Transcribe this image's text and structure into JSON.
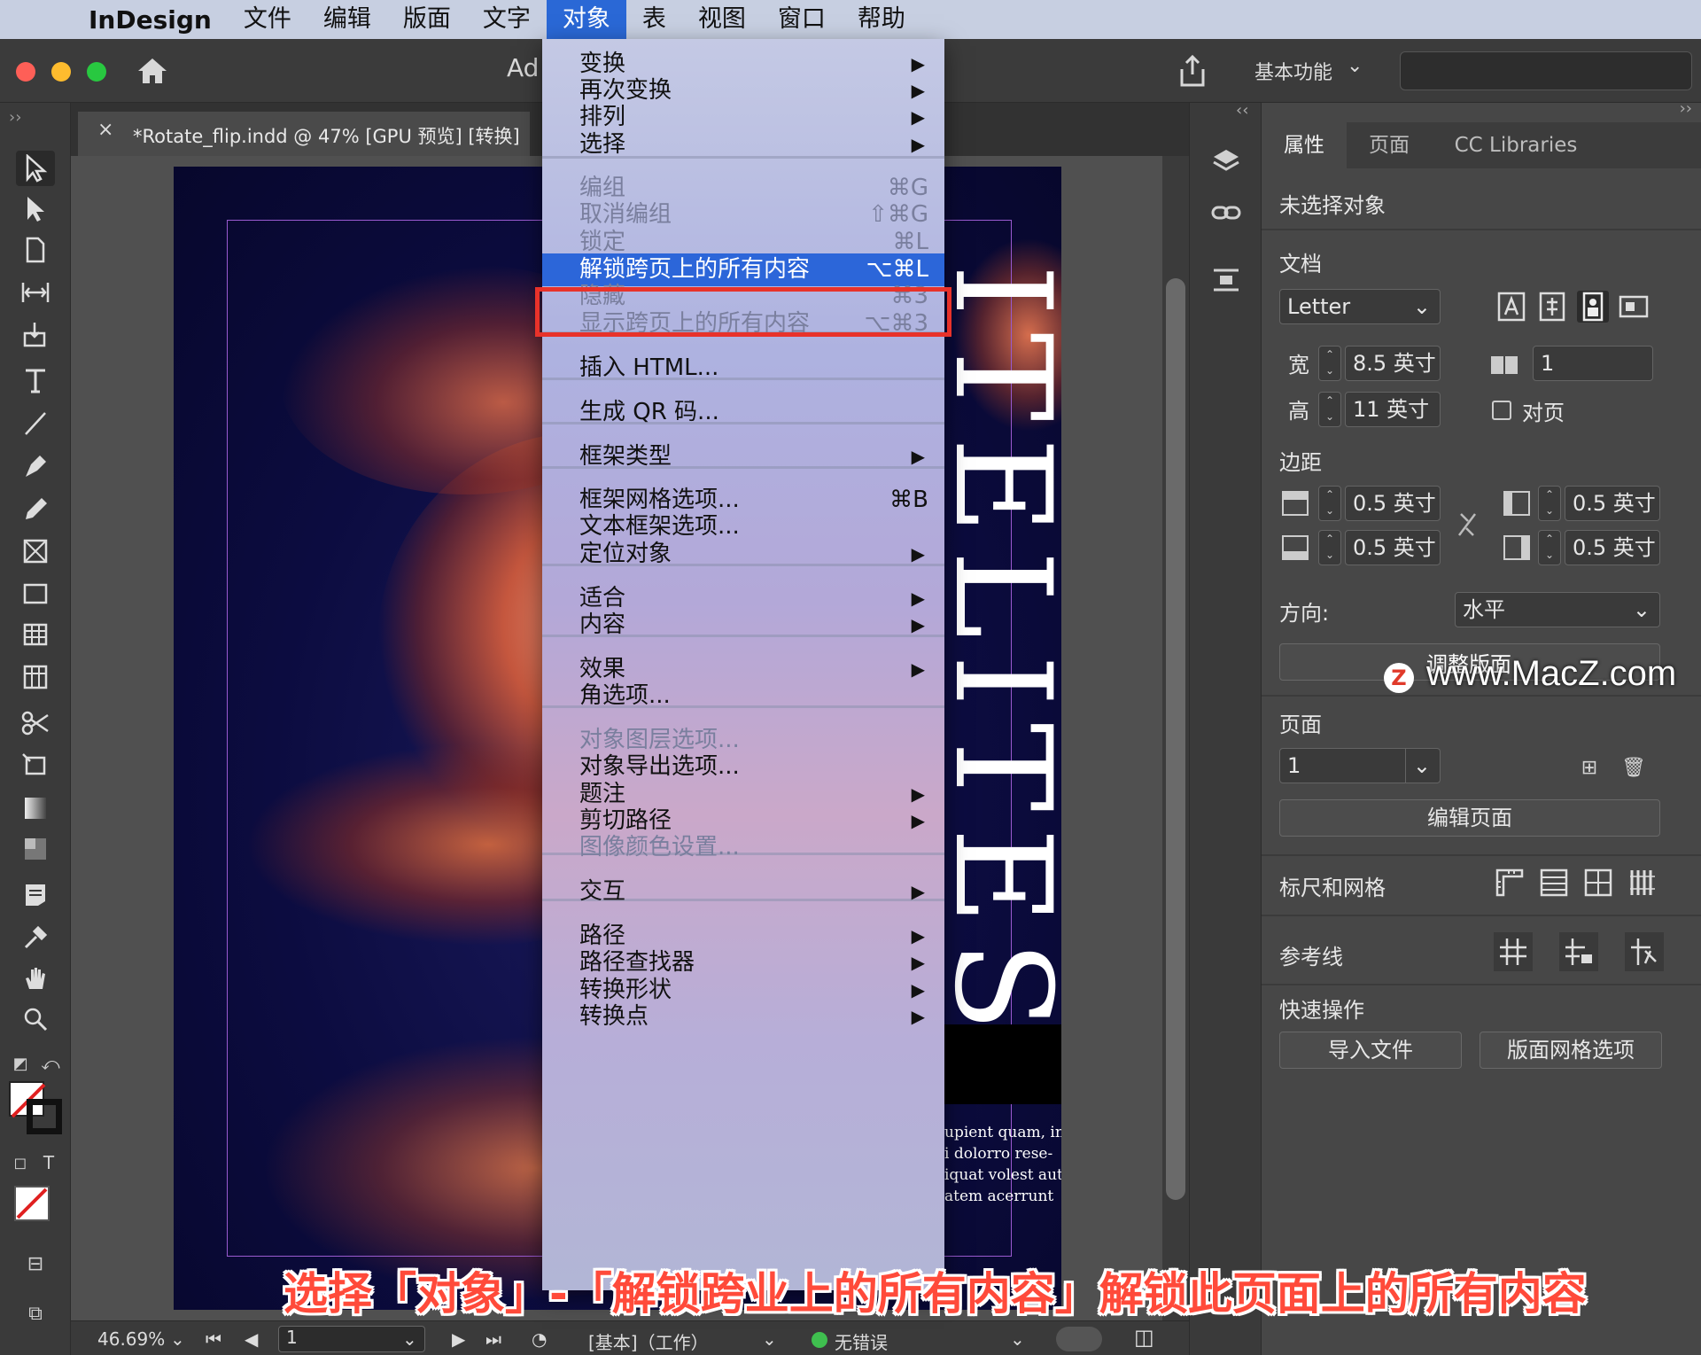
{
  "menubar": {
    "apple": "",
    "app": "InDesign",
    "items": [
      "文件",
      "编辑",
      "版面",
      "文字",
      "对象",
      "表",
      "视图",
      "窗口",
      "帮助"
    ],
    "active": "对象"
  },
  "titlebar": {
    "title_fragment": "Ad",
    "workspace": "基本功能",
    "workspace_chevron": "⌄"
  },
  "document": {
    "tab_close": "×",
    "tab_title": "*Rotate_flip.indd @ 47% [GPU 预览] [转换]",
    "headline": "ITELITES",
    "body_lines": [
      "upient quam, in",
      "i dolorro rese-",
      "iquat volest aut",
      "atem acerrunt"
    ]
  },
  "status": {
    "zoom": "46.69%",
    "page": "1",
    "preflight_profile": "[基本]（工作）",
    "errors": "无错误"
  },
  "menu": {
    "items": [
      {
        "label": "变换",
        "shortcut": "",
        "submenu": true,
        "disabled": false
      },
      {
        "label": "再次变换",
        "shortcut": "",
        "submenu": true,
        "disabled": false
      },
      {
        "label": "排列",
        "shortcut": "",
        "submenu": true,
        "disabled": false
      },
      {
        "label": "选择",
        "shortcut": "",
        "submenu": true,
        "disabled": false
      },
      {
        "label": "编组",
        "shortcut": "⌘G",
        "submenu": false,
        "disabled": true
      },
      {
        "label": "取消编组",
        "shortcut": "⇧⌘G",
        "submenu": false,
        "disabled": true
      },
      {
        "label": "锁定",
        "shortcut": "⌘L",
        "submenu": false,
        "disabled": true
      },
      {
        "label": "解锁跨页上的所有内容",
        "shortcut": "⌥⌘L",
        "submenu": false,
        "disabled": false,
        "highlighted": true
      },
      {
        "label": "隐藏",
        "shortcut": "⌘3",
        "submenu": false,
        "disabled": true
      },
      {
        "label": "显示跨页上的所有内容",
        "shortcut": "⌥⌘3",
        "submenu": false,
        "disabled": true
      },
      {
        "label": "插入 HTML...",
        "shortcut": "",
        "submenu": false,
        "disabled": false
      },
      {
        "label": "生成 QR 码...",
        "shortcut": "",
        "submenu": false,
        "disabled": false
      },
      {
        "label": "框架类型",
        "shortcut": "",
        "submenu": true,
        "disabled": false
      },
      {
        "label": "框架网格选项...",
        "shortcut": "⌘B",
        "submenu": false,
        "disabled": false
      },
      {
        "label": "文本框架选项...",
        "shortcut": "",
        "submenu": false,
        "disabled": false
      },
      {
        "label": "定位对象",
        "shortcut": "",
        "submenu": true,
        "disabled": false
      },
      {
        "label": "适合",
        "shortcut": "",
        "submenu": true,
        "disabled": false
      },
      {
        "label": "内容",
        "shortcut": "",
        "submenu": true,
        "disabled": false
      },
      {
        "label": "效果",
        "shortcut": "",
        "submenu": true,
        "disabled": false
      },
      {
        "label": "角选项...",
        "shortcut": "",
        "submenu": false,
        "disabled": false
      },
      {
        "label": "对象图层选项...",
        "shortcut": "",
        "submenu": false,
        "disabled": true
      },
      {
        "label": "对象导出选项...",
        "shortcut": "",
        "submenu": false,
        "disabled": false
      },
      {
        "label": "题注",
        "shortcut": "",
        "submenu": true,
        "disabled": false
      },
      {
        "label": "剪切路径",
        "shortcut": "",
        "submenu": true,
        "disabled": false
      },
      {
        "label": "图像颜色设置...",
        "shortcut": "",
        "submenu": false,
        "disabled": true
      },
      {
        "label": "交互",
        "shortcut": "",
        "submenu": true,
        "disabled": false
      },
      {
        "label": "路径",
        "shortcut": "",
        "submenu": true,
        "disabled": false
      },
      {
        "label": "路径查找器",
        "shortcut": "",
        "submenu": true,
        "disabled": false
      },
      {
        "label": "转换形状",
        "shortcut": "",
        "submenu": true,
        "disabled": false
      },
      {
        "label": "转换点",
        "shortcut": "",
        "submenu": true,
        "disabled": false
      }
    ]
  },
  "panel": {
    "tabs": [
      "属性",
      "页面",
      "CC Libraries"
    ],
    "no_selection": "未选择对象",
    "document_label": "文档",
    "preset": "Letter",
    "width_label": "宽",
    "width": "8.5 英寸",
    "height_label": "高",
    "height": "11 英寸",
    "pages_count": "1",
    "facing_pages": "对页",
    "margins_label": "边距",
    "margin_top": "0.5 英寸",
    "margin_bottom": "0.5 英寸",
    "margin_left": "0.5 英寸",
    "margin_right": "0.5 英寸",
    "orientation_label": "方向:",
    "orientation": "水平",
    "adjust_layout": "调整版面",
    "page_label": "页面",
    "page_value": "1",
    "edit_page": "编辑页面",
    "rulers_grids": "标尺和网格",
    "guides": "参考线",
    "quick_actions": "快速操作",
    "import_file": "导入文件",
    "layout_grid_options": "版面网格选项"
  },
  "watermark": {
    "logo": "Z",
    "text": "www.MacZ.com"
  },
  "caption": "选择「对象」-「解锁跨业上的所有内容」解锁此页面上的所有内容"
}
